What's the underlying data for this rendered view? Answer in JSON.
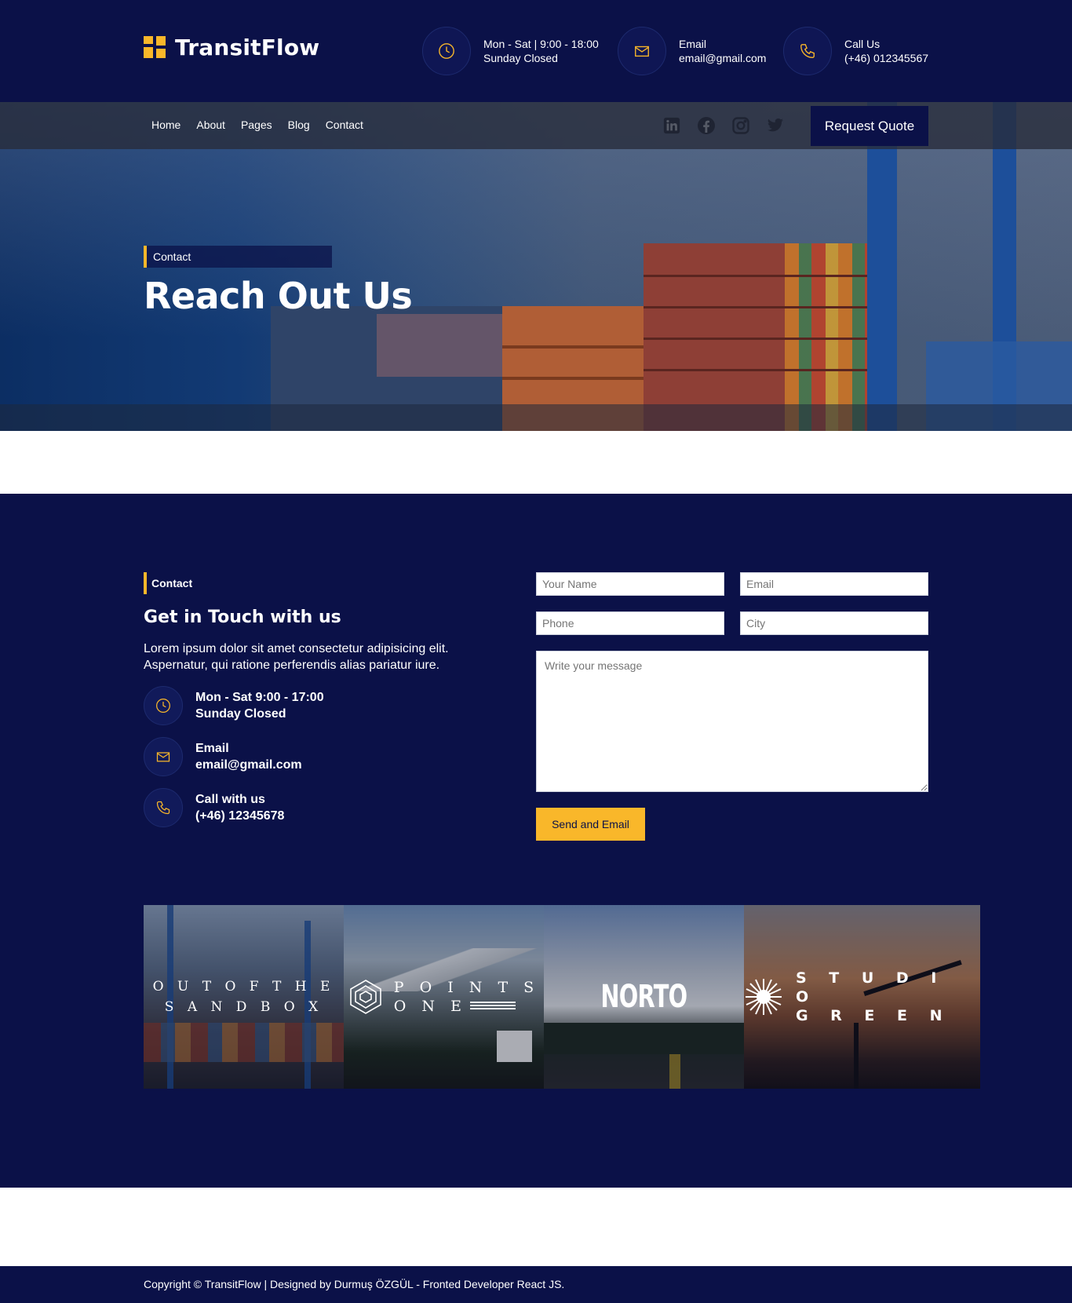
{
  "brand": {
    "name": "TransitFlow"
  },
  "header": {
    "hours": {
      "line1": "Mon - Sat | 9:00 - 18:00",
      "line2": "Sunday Closed"
    },
    "email": {
      "line1": "Email",
      "line2": "email@gmail.com"
    },
    "phone": {
      "line1": "Call Us",
      "line2": "(+46) 012345567"
    }
  },
  "nav": {
    "items": [
      "Home",
      "About",
      "Pages",
      "Blog",
      "Contact"
    ],
    "cta": "Request Quote"
  },
  "socials": [
    "linkedin-icon",
    "facebook-icon",
    "instagram-icon",
    "twitter-icon"
  ],
  "hero": {
    "tag": "Contact",
    "title": "Reach Out Us"
  },
  "contact": {
    "tag": "Contact",
    "title": "Get in Touch with us",
    "description": "Lorem ipsum dolor sit amet consectetur adipisicing elit. Aspernatur, qui ratione perferendis alias pariatur iure.",
    "items": [
      {
        "line1": "Mon - Sat 9:00 - 17:00",
        "line2": "Sunday Closed"
      },
      {
        "line1": "Email",
        "line2": "email@gmail.com"
      },
      {
        "line1": "Call with us",
        "line2": "(+46) 12345678"
      }
    ],
    "form": {
      "name_placeholder": "Your Name",
      "email_placeholder": "Email",
      "phone_placeholder": "Phone",
      "city_placeholder": "City",
      "message_placeholder": "Write your message",
      "submit": "Send and Email"
    }
  },
  "partners": [
    {
      "line1": "O U T O F T H E",
      "line2": "S A N D   B O X"
    },
    {
      "line1": "P O I N T S",
      "line2": "O N E"
    },
    {
      "line1": "NORTO"
    },
    {
      "line1": "S T U D I O",
      "line2": "G R E E N"
    }
  ],
  "footer": {
    "text": "Copyright © TransitFlow | Designed by Durmuş ÖZGÜL - Fronted Developer React JS."
  },
  "colors": {
    "navy": "#0b1148",
    "accent": "#f9b72a"
  }
}
